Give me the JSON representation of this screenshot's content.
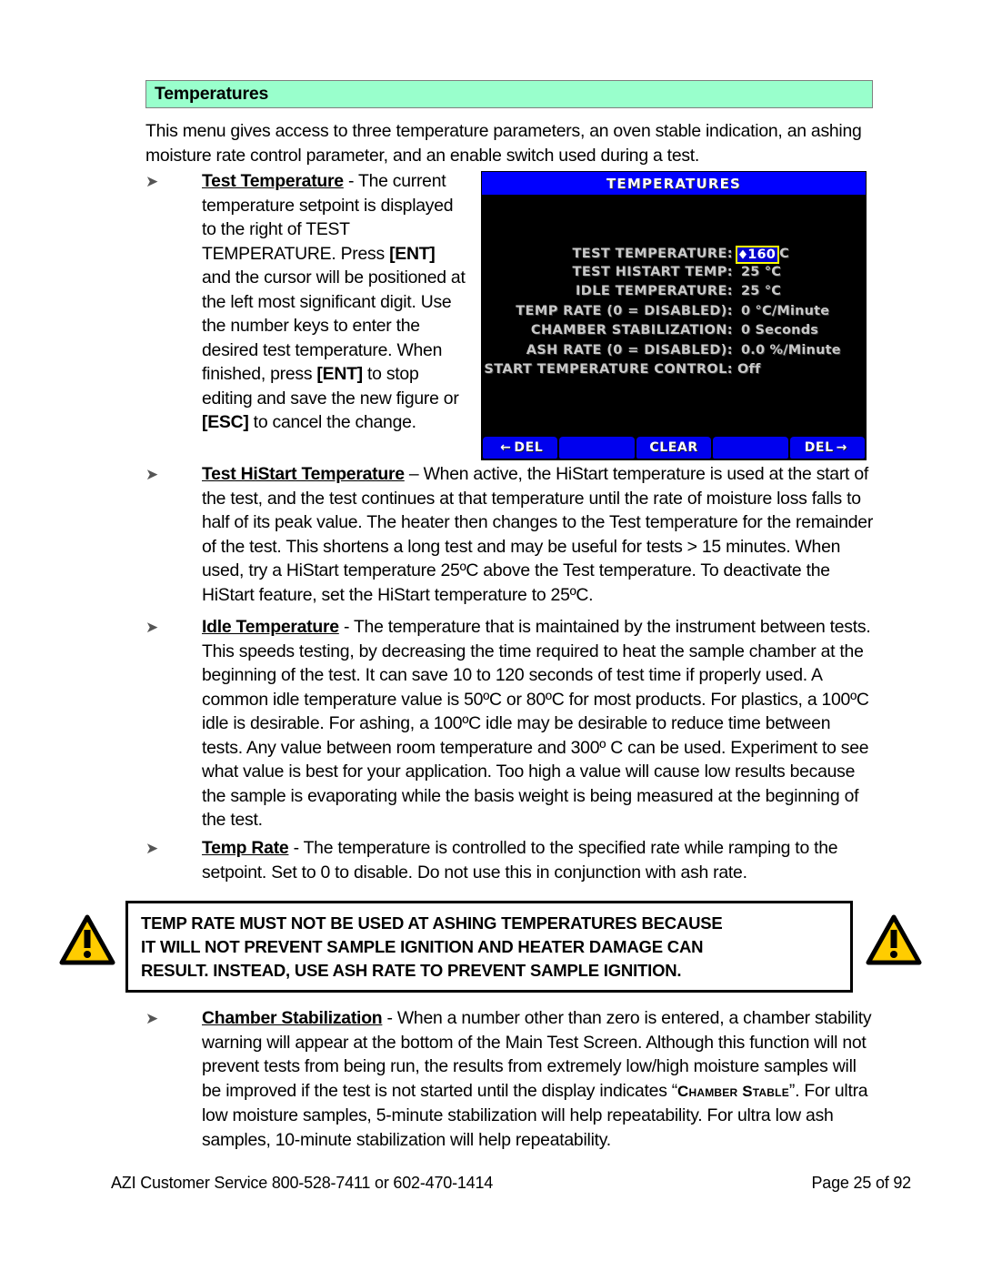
{
  "section": {
    "title": "Temperatures"
  },
  "intro": "This menu gives access to three temperature parameters, an oven stable indication, an ashing moisture rate control parameter, and an enable switch used during a test.",
  "bullets": {
    "marker": "➤",
    "test_temperature": {
      "term": "Test Temperature",
      "body": " - The current temperature setpoint is displayed to the right of TEST TEMPERATURE.  Press ",
      "key1": "[ENT]",
      "body2": " and the cursor will be positioned at the left most significant digit.  Use the number keys to enter the desired test temperature.  When finished, press ",
      "key2": "[ENT]",
      "body3": " to stop editing and save the new figure or ",
      "key3": "[ESC]",
      "body4": " to cancel the change."
    },
    "histart": {
      "term": "Test HiStart Temperature",
      "body": " – When active, the HiStart temperature is used at the start of the test, and the test continues at that temperature until the rate of moisture loss falls to half of its peak value.  The heater then changes to the Test temperature for the remainder of the test.  This shortens a long test and may be useful for tests > 15 minutes.  When used, try a HiStart temperature 25ºC above the Test temperature.  To deactivate the HiStart feature, set the HiStart temperature to 25ºC."
    },
    "idle": {
      "term": "Idle Temperature",
      "body": " - The temperature that is maintained by the instrument between tests.  This speeds testing, by decreasing the time required to heat the sample chamber at the beginning of the test.  It can save 10 to 120 seconds of test time if properly used.  A common idle temperature value is 50ºC or 80ºC for most products.  For plastics, a 100ºC idle is desirable.  For ashing, a 100ºC idle may be desirable to reduce time between tests.  Any value between room temperature and 300º C can be used.  Experiment to see what value is best for your application.  Too high a value will cause low results because the sample is evaporating while the basis weight is being measured at the beginning of the test."
    },
    "temp_rate": {
      "term": "Temp Rate",
      "body": " - The temperature is controlled to the specified rate while ramping to the setpoint.  Set to 0 to disable.  Do not use this in conjunction with ash rate."
    },
    "chamber": {
      "term": "Chamber Stabilization",
      "body": " - When a number other than zero is entered, a chamber stability warning will appear at the bottom of the Main Test Screen.  Although this function will not prevent tests from being run, the results from extremely low/high moisture samples will be improved if the test is not started until the display indicates “",
      "quoted": "Chamber Stable",
      "body2": "”.  For ultra low moisture samples, 5-minute stabilization will help repeatability.  For ultra low ash samples, 10-minute stabilization will help repeatability."
    }
  },
  "lcd": {
    "title": "TEMPERATURES",
    "rows": [
      {
        "label": "TEST TEMPERATURE:",
        "value": "",
        "editing": true,
        "edit_value": "160",
        "suffix": "C"
      },
      {
        "label": "TEST HISTART TEMP:",
        "value": "25 °C"
      },
      {
        "label": "IDLE TEMPERATURE:",
        "value": "25 °C"
      },
      {
        "label": "TEMP RATE (0 = DISABLED):",
        "value": "0 °C/Minute"
      },
      {
        "label": "CHAMBER STABILIZATION:",
        "value": "0 Seconds"
      },
      {
        "label": "ASH RATE (0 = DISABLED):",
        "value": "0.0 %/Minute"
      },
      {
        "label": "START TEMPERATURE CONTROL:",
        "value": "Off"
      }
    ],
    "softkeys": [
      {
        "label": "DEL",
        "arrow_left": "←",
        "arrow_right": ""
      },
      {
        "label": "",
        "arrow_left": "",
        "arrow_right": ""
      },
      {
        "label": "CLEAR",
        "arrow_left": "",
        "arrow_right": ""
      },
      {
        "label": "",
        "arrow_left": "",
        "arrow_right": ""
      },
      {
        "label": "DEL",
        "arrow_left": "",
        "arrow_right": "→"
      }
    ],
    "colors": {
      "titlebar": "#0000FF",
      "screen": "#000000",
      "text": "#C8C8C8",
      "edit_bg": "#0000CC",
      "edit_border": "#FFFF00",
      "softkey": "#0000EE"
    }
  },
  "warning": {
    "lines": [
      "TEMP RATE MUST NOT BE USED AT ASHING TEMPERATURES BECAUSE",
      "IT WILL NOT PREVENT SAMPLE IGNITION AND HEATER DAMAGE CAN",
      "RESULT.  INSTEAD, USE ASH RATE TO PREVENT SAMPLE IGNITION."
    ],
    "icon_color": "#FFCC00"
  },
  "footer": {
    "left": "AZI Customer Service 800-528-7411 or 602-470-1414",
    "right": "Page 25 of 92"
  }
}
